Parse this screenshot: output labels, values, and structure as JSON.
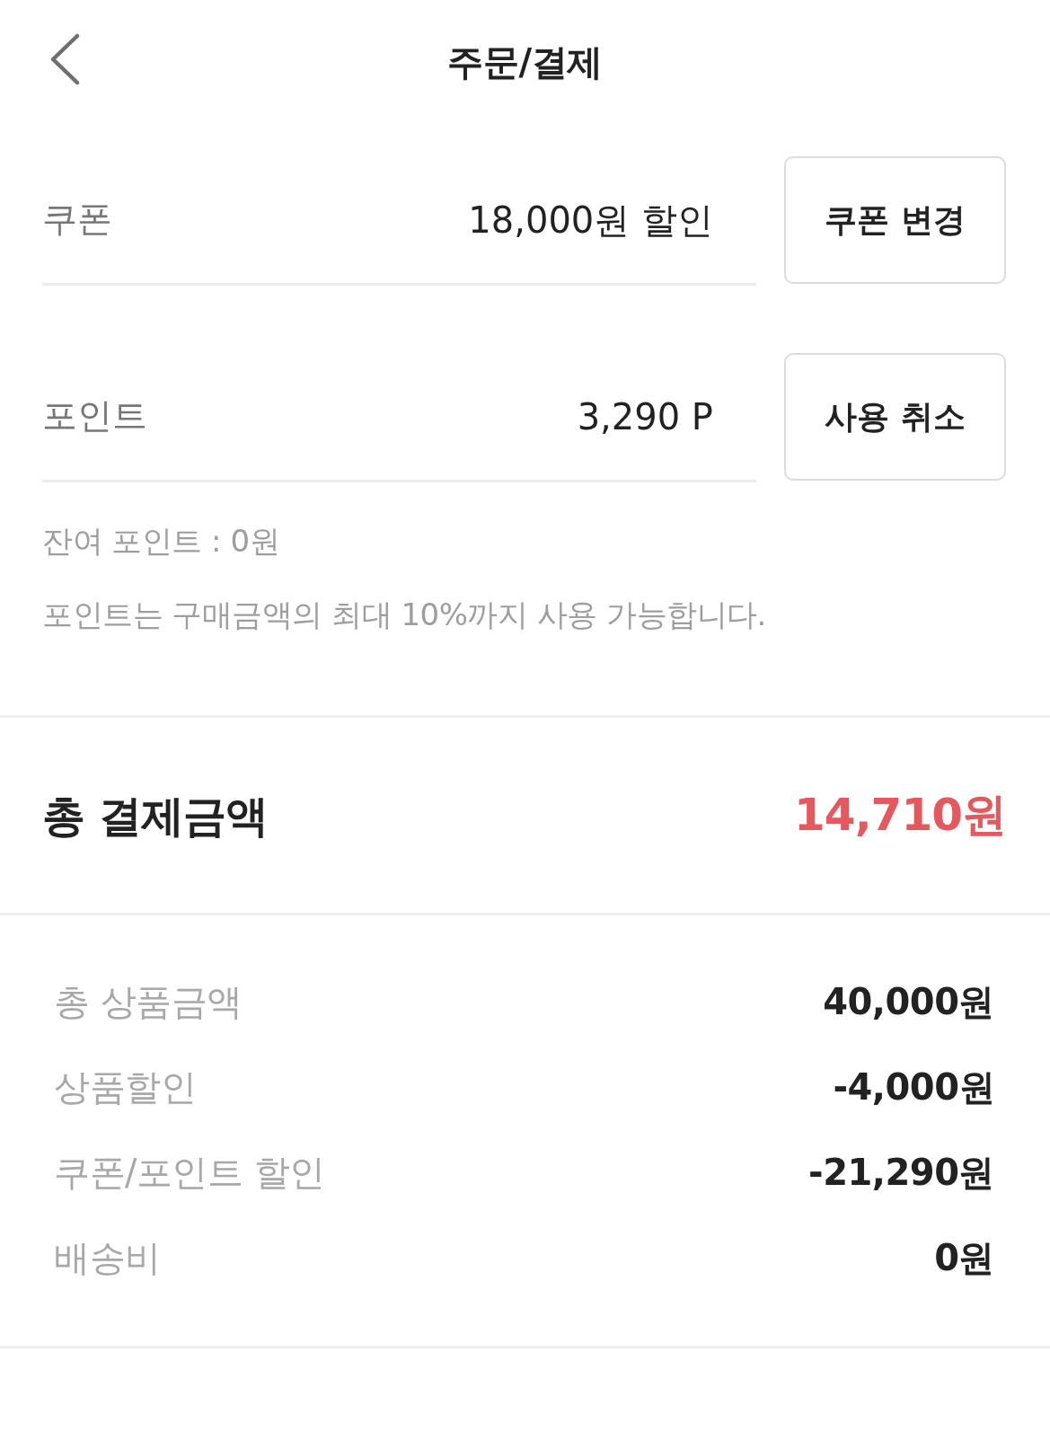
{
  "header": {
    "title": "주문/결제"
  },
  "discount_rows": [
    {
      "label": "쿠폰",
      "value": "18,000원 할인",
      "button": "쿠폰 변경"
    },
    {
      "label": "포인트",
      "value": "3,290 P",
      "button": "사용 취소"
    }
  ],
  "point_notes": [
    "잔여 포인트 : 0원",
    "포인트는 구매금액의 최대 10%까지 사용 가능합니다."
  ],
  "total": {
    "label": "총 결제금액",
    "amount": "14,710원"
  },
  "breakdown": [
    {
      "label": "총 상품금액",
      "value": "40,000원"
    },
    {
      "label": "상품할인",
      "value": "-4,000원"
    },
    {
      "label": "쿠폰/포인트 할인",
      "value": "-21,290원"
    },
    {
      "label": "배송비",
      "value": "0원"
    }
  ]
}
